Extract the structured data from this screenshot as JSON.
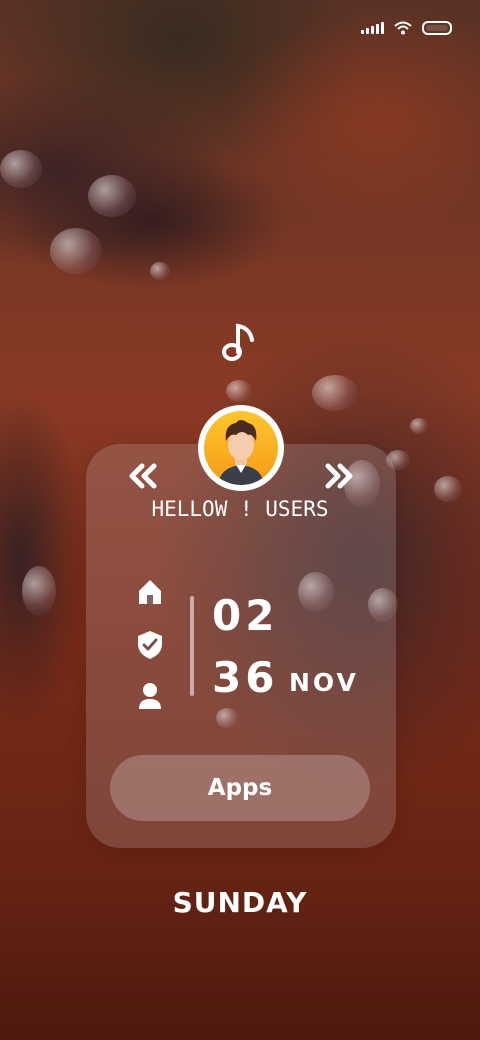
{
  "status_bar": {
    "icons": [
      "signal-icon",
      "wifi-icon",
      "battery-icon"
    ]
  },
  "music": {
    "icon": "music-note-icon"
  },
  "profile": {
    "avatar_icon": "user-avatar",
    "greeting": "HELLOW ! USERS"
  },
  "nav": {
    "prev_icon": "double-chevron-left-icon",
    "next_icon": "double-chevron-right-icon"
  },
  "sidebar": {
    "icons": [
      "home-icon",
      "shield-check-icon",
      "user-icon"
    ]
  },
  "clock": {
    "hour": "02",
    "minute": "36",
    "month": "NOV"
  },
  "apps_button": {
    "label": "Apps"
  },
  "day": {
    "label": "SUNDAY"
  },
  "colors": {
    "avatar_bg": "#f59a19",
    "card_bg": "rgba(200,190,195,0.22)"
  }
}
